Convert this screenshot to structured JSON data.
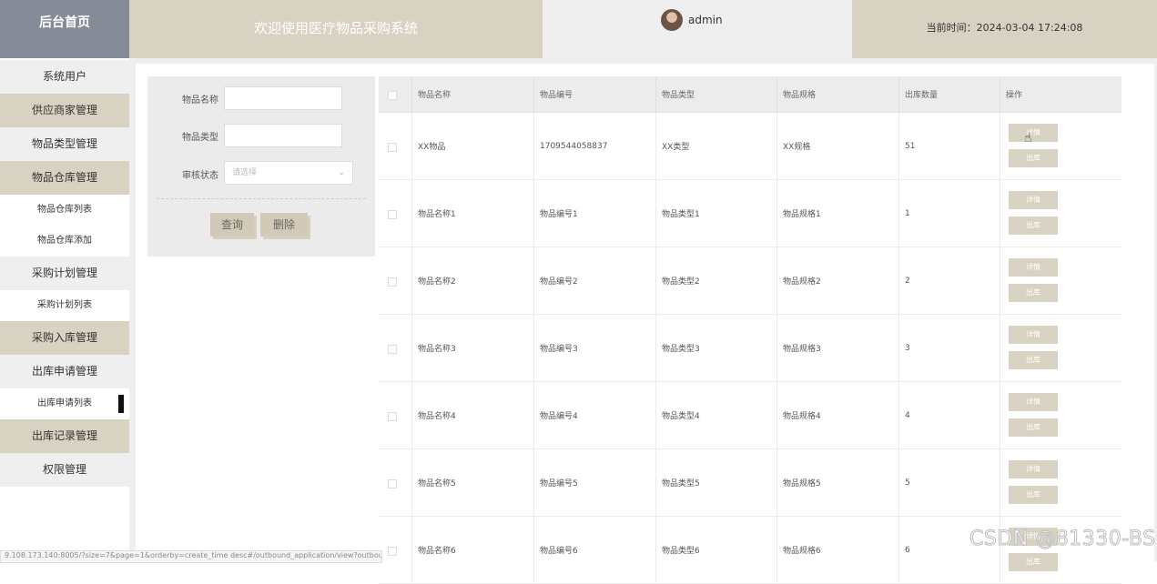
{
  "header": {
    "brand": "后台首页",
    "banner": "欢迎使用医疗物品采购系统",
    "username": "admin",
    "time_label": "当前时间：2024-03-04 17:24:08"
  },
  "sidebar": {
    "items": [
      {
        "label": "系统用户"
      },
      {
        "label": "供应商家管理"
      },
      {
        "label": "物品类型管理"
      },
      {
        "label": "物品仓库管理"
      },
      {
        "label": "物品仓库列表"
      },
      {
        "label": "物品仓库添加"
      },
      {
        "label": "采购计划管理"
      },
      {
        "label": "采购计划列表"
      },
      {
        "label": "采购入库管理"
      },
      {
        "label": "出库申请管理"
      },
      {
        "label": "出库申请列表"
      },
      {
        "label": "出库记录管理"
      },
      {
        "label": "权限管理"
      }
    ]
  },
  "search": {
    "name_label": "物品名称",
    "name_value": "",
    "type_label": "物品类型",
    "type_value": "",
    "status_label": "审核状态",
    "status_placeholder": "请选择",
    "query_button": "查询",
    "delete_button": "删除"
  },
  "table": {
    "columns": [
      "物品名称",
      "物品编号",
      "物品类型",
      "物品规格",
      "出库数量",
      "操作"
    ],
    "detail_label": "详情",
    "outbound_label": "出库",
    "rows": [
      {
        "name": "XX物品",
        "code": "1709544058837",
        "type": "XX类型",
        "spec": "XX规格",
        "qty": "51"
      },
      {
        "name": "物品名称1",
        "code": "物品编号1",
        "type": "物品类型1",
        "spec": "物品规格1",
        "qty": "1"
      },
      {
        "name": "物品名称2",
        "code": "物品编号2",
        "type": "物品类型2",
        "spec": "物品规格2",
        "qty": "2"
      },
      {
        "name": "物品名称3",
        "code": "物品编号3",
        "type": "物品类型3",
        "spec": "物品规格3",
        "qty": "3"
      },
      {
        "name": "物品名称4",
        "code": "物品编号4",
        "type": "物品类型4",
        "spec": "物品规格4",
        "qty": "4"
      },
      {
        "name": "物品名称5",
        "code": "物品编号5",
        "type": "物品类型5",
        "spec": "物品规格5",
        "qty": "5"
      },
      {
        "name": "物品名称6",
        "code": "物品编号6",
        "type": "物品类型6",
        "spec": "物品规格6",
        "qty": "6"
      }
    ]
  },
  "status_url": "9.108.173.140:8005/?size=7&page=1&orderby=create_time desc#/outbound_application/view?outbound...",
  "watermark": "CSDN @81330-BS",
  "colors": {
    "beige": "#d8d2c2",
    "brand_bg": "#858c97",
    "light_grey": "#efefef"
  }
}
